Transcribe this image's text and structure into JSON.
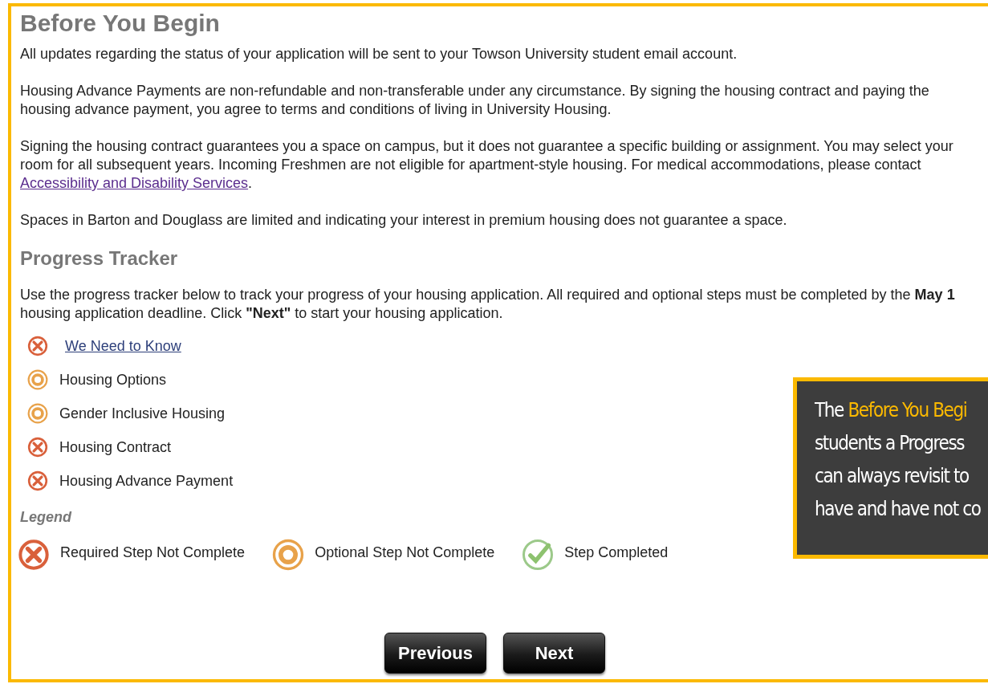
{
  "title": "Before You Begin",
  "intro": [
    {
      "text": "All updates regarding the status of your application will be sent to your Towson University student email account."
    },
    {
      "text": "Housing Advance Payments are non-refundable and non-transferable under any circumstance. By signing the housing contract and paying the housing advance payment, you agree to terms and conditions of living in University Housing."
    },
    {
      "text": "Signing the housing contract guarantees you a space on campus, but it does not guarantee a specific building or assignment. You may select your room for all subsequent years. Incoming Freshmen are not eligible for apartment-style housing.  For medical accommodations, please contact ",
      "link": "Accessibility and Disability Services",
      "after": "."
    },
    {
      "text": "Spaces in Barton and Douglass are limited and indicating your interest in premium housing does not guarantee a space."
    }
  ],
  "tracker": {
    "title": "Progress Tracker",
    "description": "Use the progress tracker below to track your progress of your housing application. All required and optional steps must be completed by the **May 1** housing application deadline. Click **\"Next\"** to start your housing application.",
    "steps": [
      {
        "label": "We Need to Know",
        "kind": "required",
        "link": true
      },
      {
        "label": "Housing Options",
        "kind": "optional",
        "link": false
      },
      {
        "label": "Gender Inclusive Housing",
        "kind": "optional",
        "link": false
      },
      {
        "label": "Housing Contract",
        "kind": "required",
        "link": false
      },
      {
        "label": "Housing Advance Payment",
        "kind": "required",
        "link": false
      }
    ]
  },
  "legend": {
    "title": "Legend",
    "items": [
      {
        "label": "Required Step Not Complete",
        "kind": "required"
      },
      {
        "label": "Optional Step Not Complete",
        "kind": "optional"
      },
      {
        "label": "Step Completed",
        "kind": "completed"
      }
    ]
  },
  "buttons": [
    "Previous",
    "Next"
  ],
  "callout": {
    "lines": [
      [
        {
          "text": "The ",
          "highlight": false
        },
        {
          "text": "Before You Begi",
          "highlight": true
        }
      ],
      [
        {
          "text": "students a Progress",
          "highlight": false
        }
      ],
      [
        {
          "text": "can always revisit to",
          "highlight": false
        }
      ],
      [
        {
          "text": "have and have not co",
          "highlight": false
        }
      ]
    ]
  }
}
